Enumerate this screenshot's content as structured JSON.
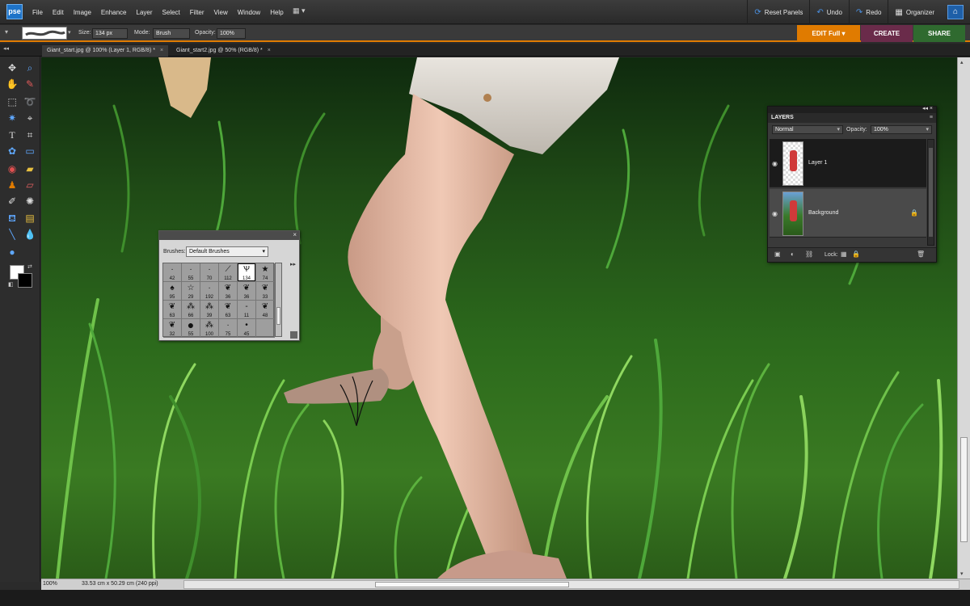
{
  "app": {
    "logo": "pse"
  },
  "menu": [
    "File",
    "Edit",
    "Image",
    "Enhance",
    "Layer",
    "Select",
    "Filter",
    "View",
    "Window",
    "Help"
  ],
  "topbar": {
    "reset_panels": "Reset Panels",
    "undo": "Undo",
    "redo": "Redo",
    "organizer": "Organizer"
  },
  "options": {
    "size_label": "Size:",
    "size_value": "134 px",
    "mode_label": "Mode:",
    "mode_value": "Brush",
    "opacity_label": "Opacity:",
    "opacity_value": "100%"
  },
  "modes": {
    "edit": "EDIT Full",
    "create": "CREATE",
    "share": "SHARE"
  },
  "tabs": [
    {
      "label": "Giant_start.jpg @ 100% (Layer 1, RGB/8) *"
    },
    {
      "label": "Giant_start2.jpg @ 50% (RGB/8) *"
    }
  ],
  "brushes": {
    "label": "Brushes:",
    "set": "Default Brushes",
    "sizes": [
      "42",
      "55",
      "70",
      "112",
      "134",
      "74",
      "95",
      "29",
      "192",
      "36",
      "36",
      "33",
      "63",
      "66",
      "39",
      "63",
      "11",
      "48",
      "32",
      "55",
      "100",
      "75",
      "45",
      ""
    ]
  },
  "layers": {
    "title": "LAYERS",
    "blend": "Normal",
    "opacity_label": "Opacity:",
    "opacity": "100%",
    "items": [
      {
        "name": "Layer 1"
      },
      {
        "name": "Background"
      }
    ],
    "lock_label": "Lock:"
  },
  "status": {
    "zoom": "100%",
    "dims": "33.53 cm x 50.29 cm (240 ppi)"
  },
  "colors": {
    "accent": "#e07b00",
    "create": "#6a2b4a",
    "share": "#2f6a2f",
    "selection": "#1e73c8"
  }
}
